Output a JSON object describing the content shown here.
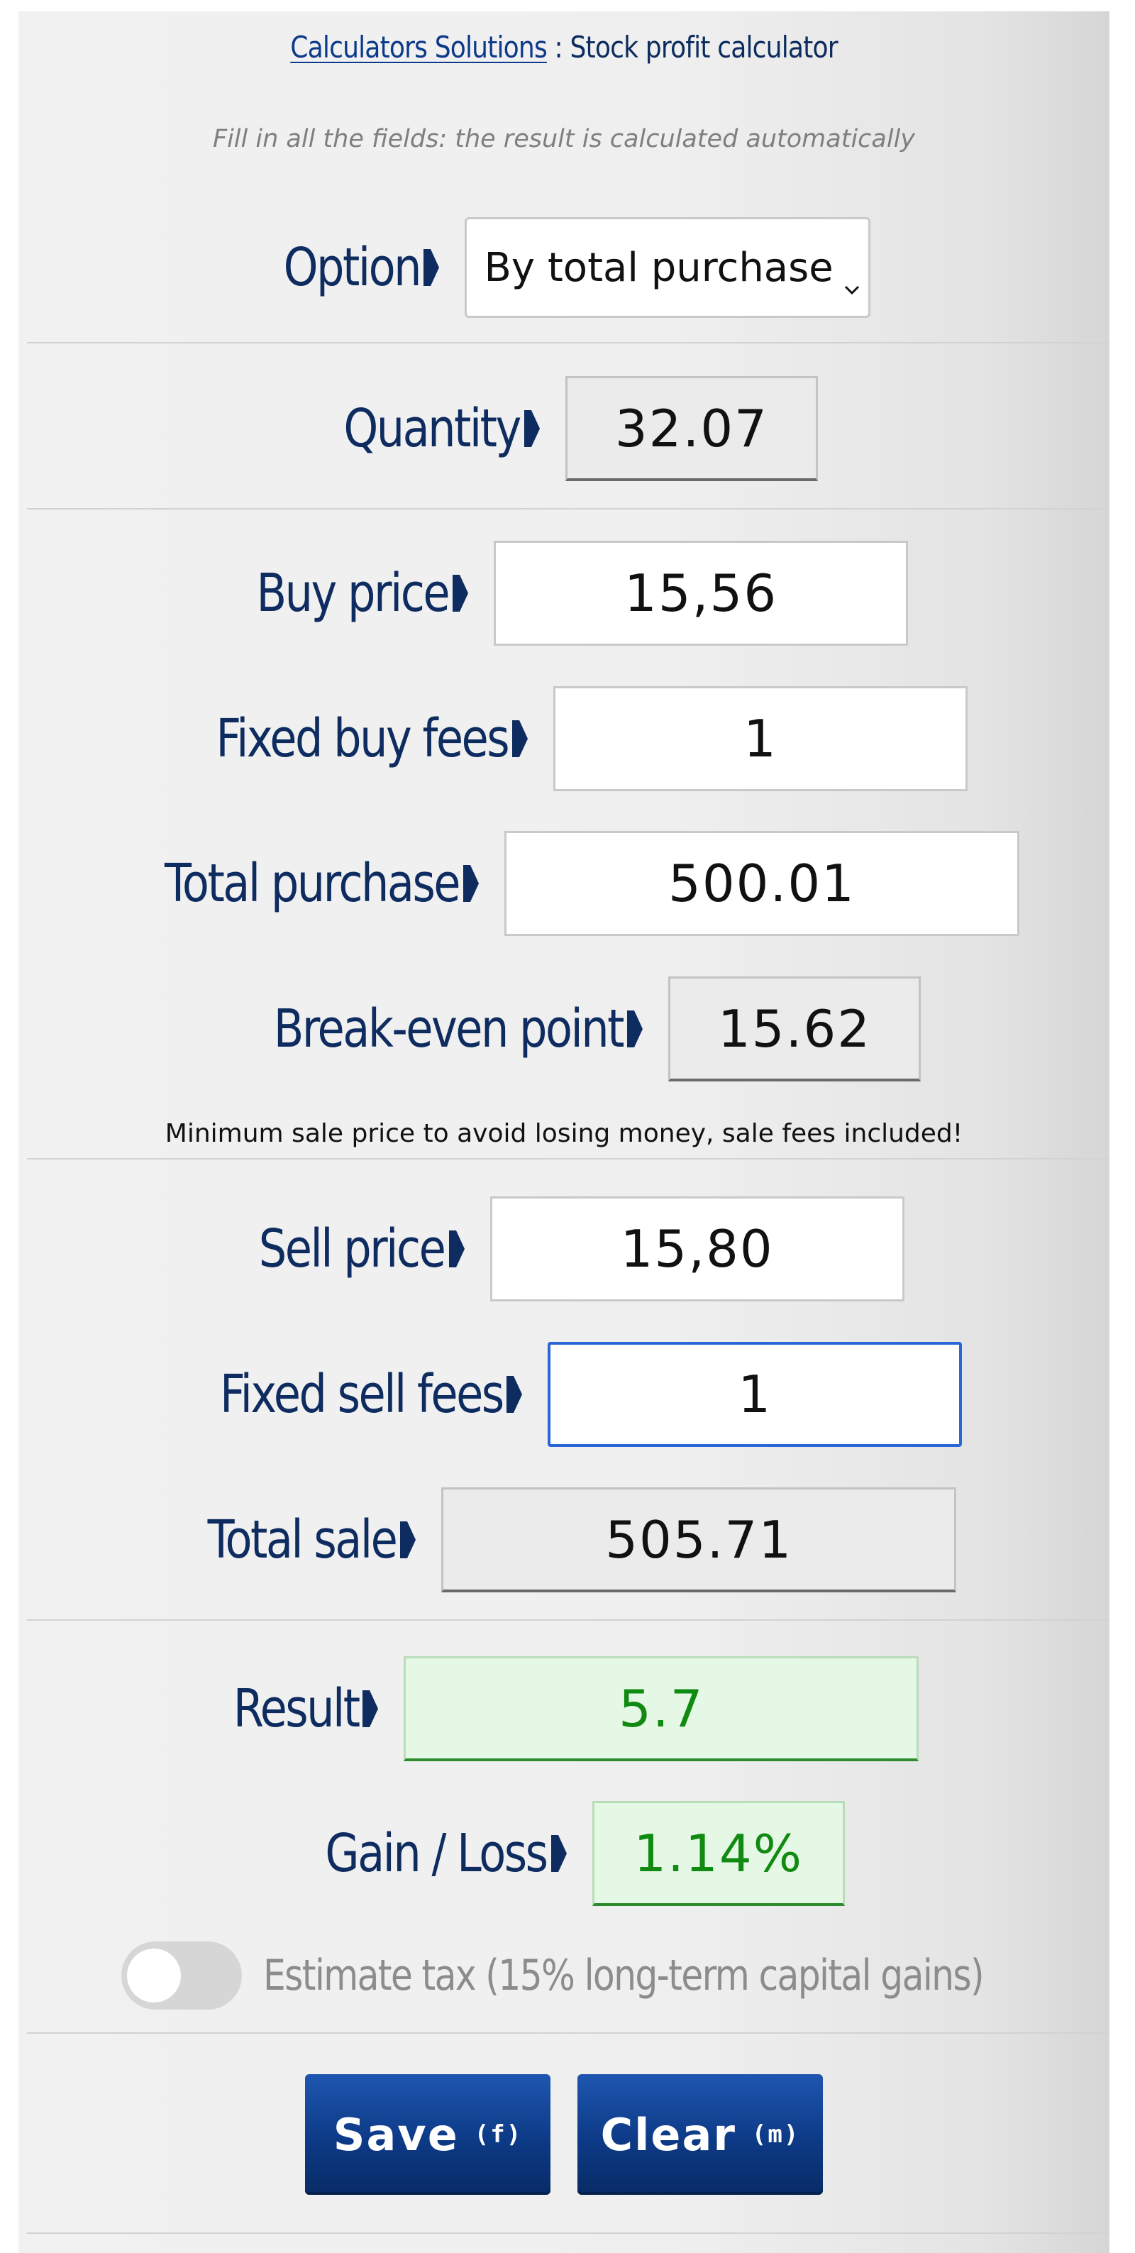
{
  "header": {
    "site_link": "Calculators Solutions",
    "separator": " : ",
    "title": "Stock profit calculator"
  },
  "instructions": "Fill in all the fields: the result is calculated automatically",
  "option": {
    "label": "Option",
    "selected": "By total purchase"
  },
  "quantity": {
    "label": "Quantity",
    "value": "32.07"
  },
  "buy_price": {
    "label": "Buy price",
    "value": "15,56"
  },
  "fixed_buy_fees": {
    "label": "Fixed buy fees",
    "value": "1"
  },
  "total_purchase": {
    "label": "Total purchase",
    "value": "500.01"
  },
  "break_even": {
    "label": "Break-even point",
    "value": "15.62",
    "note": "Minimum sale price to avoid losing money, sale fees included!"
  },
  "sell_price": {
    "label": "Sell price",
    "value": "15,80"
  },
  "fixed_sell_fees": {
    "label": "Fixed sell fees",
    "value": "1"
  },
  "total_sale": {
    "label": "Total sale",
    "value": "505.71"
  },
  "result": {
    "label": "Result",
    "value": "5.7"
  },
  "gain_loss": {
    "label": "Gain / Loss",
    "value": "1.14%"
  },
  "estimate_tax": {
    "label": "Estimate tax (15% long-term capital gains)",
    "enabled": false
  },
  "buttons": {
    "save_label": "Save",
    "save_key": "(f)",
    "clear_label": "Clear",
    "clear_key": "(m)"
  },
  "colors": {
    "label": "#0e2c60",
    "button": "#0d3a86",
    "result_text": "#118a11",
    "result_bg": "#e5f8e5",
    "focus": "#2a66d8"
  },
  "icons": {
    "label_arrow": "arrow-right-icon",
    "select_chevron": "chevron-down-icon"
  }
}
